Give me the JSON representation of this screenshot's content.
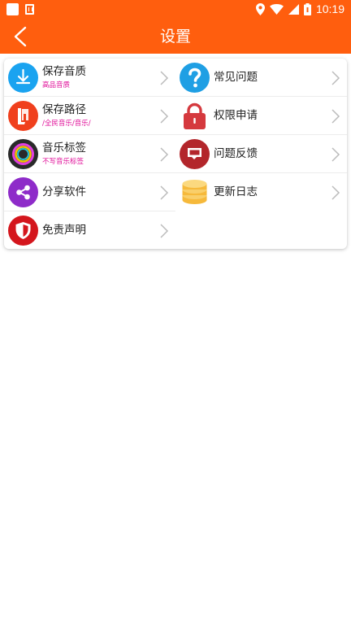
{
  "status_bar": {
    "time": "10:19",
    "icons": [
      "square-icon",
      "a-notification-icon",
      "location-icon",
      "wifi-icon",
      "signal-icon",
      "battery-icon"
    ]
  },
  "header": {
    "title": "设置",
    "back_icon": "back-arrow-icon"
  },
  "colors": {
    "accent": "#ff5e0e",
    "subtext": "#e0109a"
  },
  "settings_left": [
    {
      "label": "保存音质",
      "sub": "高品音质",
      "icon": "download-icon"
    },
    {
      "label": "保存路径",
      "sub": "/全民音乐/音乐/",
      "icon": "folder-path-icon"
    },
    {
      "label": "音乐标签",
      "sub": "不写音乐标签",
      "icon": "music-tag-icon"
    },
    {
      "label": "分享软件",
      "sub": "",
      "icon": "share-icon"
    },
    {
      "label": "免责声明",
      "sub": "",
      "icon": "shield-icon"
    }
  ],
  "settings_right": [
    {
      "label": "常见问题",
      "sub": "",
      "icon": "question-icon"
    },
    {
      "label": "权限申请",
      "sub": "",
      "icon": "lock-icon"
    },
    {
      "label": "问题反馈",
      "sub": "",
      "icon": "feedback-icon"
    },
    {
      "label": "更新日志",
      "sub": "",
      "icon": "coins-stack-icon"
    }
  ]
}
